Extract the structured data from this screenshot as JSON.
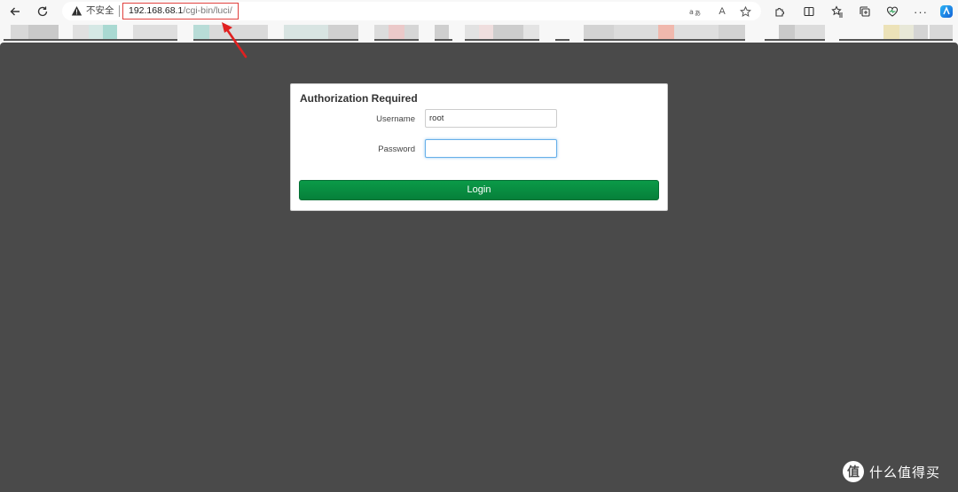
{
  "browser": {
    "security_label": "不安全",
    "url_host": "192.168.68.1",
    "url_path": "/cgi-bin/luci/",
    "read_aloud_label": "A",
    "url_highlight_color": "#e0403d"
  },
  "login": {
    "title": "Authorization Required",
    "username_label": "Username",
    "username_value": "root",
    "password_label": "Password",
    "password_value": "",
    "login_button": "Login",
    "button_color": "#06803a"
  },
  "watermark": {
    "logo_glyph": "值",
    "text": "什么值得买"
  },
  "icons": {
    "back": "back-arrow-icon",
    "refresh": "refresh-icon",
    "warning": "warning-icon",
    "translate": "translate-icon",
    "star": "star-icon",
    "extensions": "extensions-icon",
    "split_screen": "split-screen-icon",
    "favorites": "favorites-icon",
    "collections": "collections-icon",
    "performance": "performance-heart-icon",
    "more": "more-icon",
    "copilot": "copilot-icon"
  },
  "colors": {
    "page_background": "#4a4a4a",
    "toolbar_background": "#f7f7f7"
  }
}
